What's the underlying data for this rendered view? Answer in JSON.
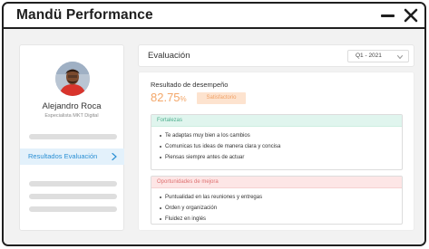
{
  "window": {
    "app_title": "Mandü Performance"
  },
  "sidebar": {
    "user_name": "Alejandro Roca",
    "user_role": "Especialista MKT Digital",
    "active_item_label": "Resultados Evaluación",
    "active_item_icon": "chevron-right-icon"
  },
  "main": {
    "title": "Evaluación",
    "period": {
      "selected": "Q1 - 2021",
      "icon": "chevron-down-icon"
    },
    "result": {
      "label": "Resultado de desempeño",
      "score_value": "82.75",
      "score_unit": "%",
      "status": "Satisfactorio"
    },
    "strengths": {
      "title": "Fortalezas",
      "items": [
        "Te adaptas muy bien a los cambios",
        "Comunicas tus ideas de manera clara y concisa",
        "Piensas siempre antes de actuar"
      ]
    },
    "opportunities": {
      "title": "Oportunidades de mejora",
      "items": [
        "Puntualidad en las reuniones y entregas",
        "Orden y organización",
        "Fluidez en inglés"
      ]
    }
  },
  "colors": {
    "accent_blue": "#2a8fd4",
    "score_orange": "#f3a76a",
    "strengths_green": "#4cae8d",
    "opportunities_red": "#de7070"
  }
}
